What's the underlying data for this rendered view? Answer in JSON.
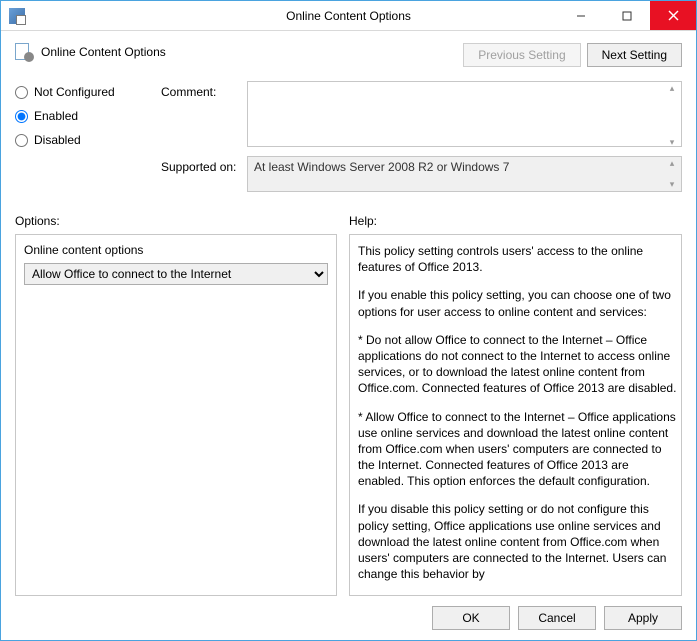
{
  "window": {
    "title": "Online Content Options"
  },
  "header": {
    "title": "Online Content Options",
    "previous_label": "Previous Setting",
    "next_label": "Next Setting"
  },
  "radios": {
    "not_configured": "Not Configured",
    "enabled": "Enabled",
    "disabled": "Disabled",
    "selected": "enabled"
  },
  "fields": {
    "comment_label": "Comment:",
    "comment_value": "",
    "supported_label": "Supported on:",
    "supported_value": "At least Windows Server 2008 R2 or Windows 7"
  },
  "sections": {
    "options_label": "Options:",
    "help_label": "Help:"
  },
  "options": {
    "group_label": "Online content options",
    "selected": "Allow Office to connect to the Internet",
    "items": [
      "Allow Office to connect to the Internet"
    ]
  },
  "help": {
    "p1": "This policy setting controls users' access to the online features of Office 2013.",
    "p2": "If you enable this policy setting, you can choose one of two options for user access to online content and services:",
    "p3": "* Do not allow Office to connect to the Internet – Office applications do not connect to the Internet to access online services, or to download the latest online content from Office.com. Connected features of Office 2013 are disabled.",
    "p4": "* Allow Office to connect to the Internet – Office applications use online services and download the latest online content from Office.com when users' computers are connected to the Internet. Connected features of Office 2013 are enabled. This option enforces the default configuration.",
    "p5": "If you disable this policy setting or do not configure this policy setting, Office applications use online services and download the latest online content from Office.com when users' computers are connected to the Internet. Users can change this behavior by"
  },
  "footer": {
    "ok": "OK",
    "cancel": "Cancel",
    "apply": "Apply"
  }
}
